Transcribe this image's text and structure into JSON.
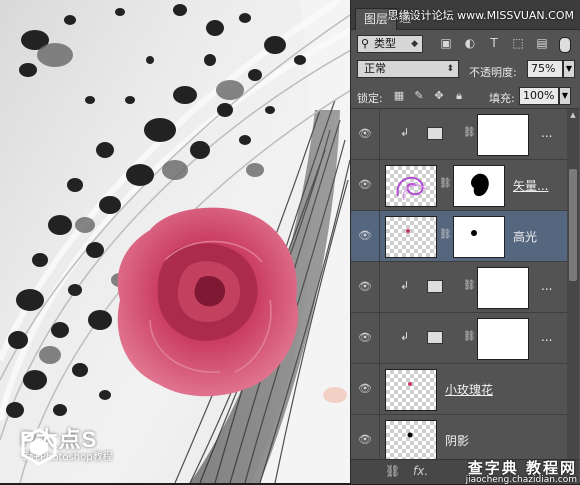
{
  "panel": {
    "tabs": [
      "图层",
      "通"
    ],
    "top_watermark": "思缘设计论坛 www.MISSVUAN.COM",
    "filter": {
      "selected": "类型",
      "icons": [
        "image-filter-icon",
        "adjustment-filter-icon",
        "text-filter-icon",
        "shape-filter-icon",
        "smart-object-filter-icon"
      ]
    },
    "blend_mode": "正常",
    "opacity_label": "不透明度:",
    "opacity_value": "75%",
    "lock_label": "锁定:",
    "fill_label": "填充:",
    "fill_value": "100%",
    "layers": [
      {
        "name": "",
        "more": "...",
        "type": "adjustment",
        "clipped": true,
        "selected": false
      },
      {
        "name": "矢量...",
        "type": "vector-mask",
        "clipped": false,
        "selected": false
      },
      {
        "name": "高光",
        "type": "mask",
        "clipped": false,
        "selected": true
      },
      {
        "name": "",
        "more": "...",
        "type": "adjustment",
        "clipped": true,
        "selected": false
      },
      {
        "name": "",
        "more": "...",
        "type": "curves",
        "clipped": true,
        "selected": false
      },
      {
        "name": "小玫瑰花",
        "type": "pixel",
        "clipped": false,
        "selected": false
      },
      {
        "name": "阴影",
        "type": "pixel",
        "clipped": false,
        "selected": false
      }
    ],
    "bottom_icons": [
      "link-icon",
      "fx-icon"
    ],
    "bottom_watermark": {
      "brand": "查字典 教程网",
      "url": "jiaocheng.chazidian.com"
    }
  },
  "logo": {
    "title": "P大点S",
    "subtitle": "专注Photoshop教程"
  },
  "colors": {
    "panel_bg": "#535353",
    "selected_layer": "#55677e",
    "rose": "#c8395e"
  }
}
